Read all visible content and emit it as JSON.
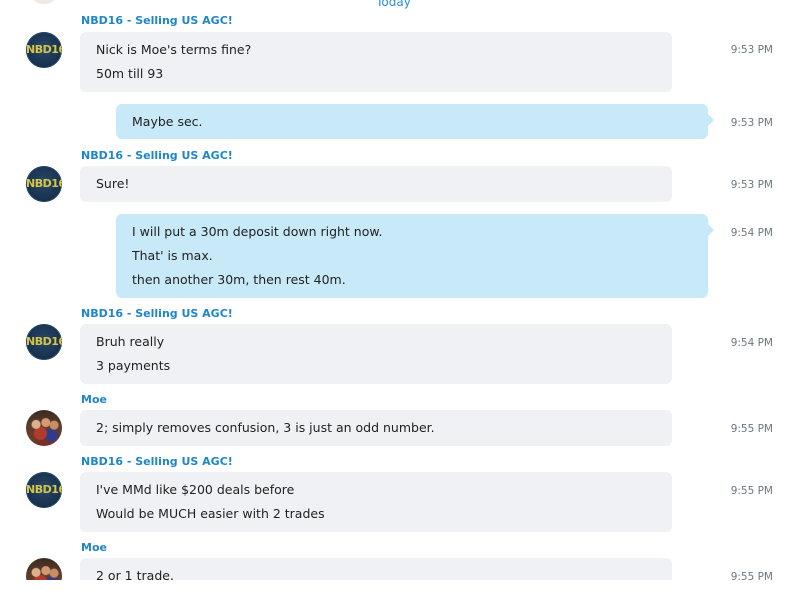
{
  "date_divider": "Today",
  "messages": [
    {
      "sender": "NBD16 - Selling US AGC!",
      "avatar_label": "NBD16",
      "lines": [
        "Nick is Moe's terms fine?",
        "50m till 93"
      ],
      "time": "9:53 PM"
    },
    {
      "lines": [
        "Maybe sec."
      ],
      "time": "9:53 PM"
    },
    {
      "sender": "NBD16 - Selling US AGC!",
      "avatar_label": "NBD16",
      "lines": [
        "Sure!"
      ],
      "time": "9:53 PM"
    },
    {
      "lines": [
        "I will put a 30m deposit down right now.",
        "That' is max.",
        "then another 30m, then rest 40m."
      ],
      "time": "9:54 PM"
    },
    {
      "sender": "NBD16 - Selling US AGC!",
      "avatar_label": "NBD16",
      "lines": [
        "Bruh really",
        "3 payments"
      ],
      "time": "9:54 PM"
    },
    {
      "sender": "Moe",
      "lines": [
        "2; simply removes confusion, 3 is just an odd number."
      ],
      "time": "9:55 PM"
    },
    {
      "sender": "NBD16 - Selling US AGC!",
      "avatar_label": "NBD16",
      "lines": [
        "I've MMd like $200 deals before",
        "Would be MUCH easier with 2 trades"
      ],
      "time": "9:55 PM"
    },
    {
      "sender": "Moe",
      "lines": [
        "2 or 1 trade."
      ],
      "time": "9:55 PM"
    }
  ],
  "colors": {
    "incoming_bubble": "#eff1f5",
    "outgoing_bubble": "#c7e9f8",
    "sender_name": "#1f86c7",
    "timestamp": "#6b7780"
  }
}
